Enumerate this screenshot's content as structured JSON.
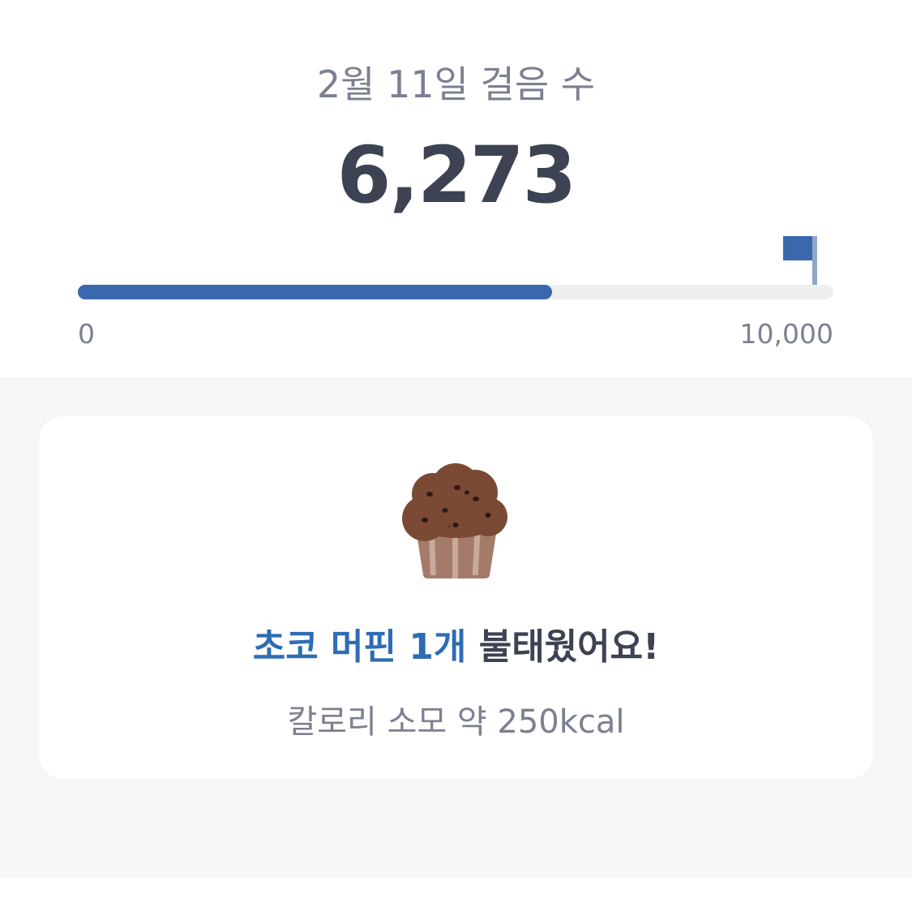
{
  "summary": {
    "date_label": "2월 11일 걸음 수",
    "steps": "6,273",
    "steps_value": 6273,
    "goal_value": 10000,
    "progress_fraction": 0.6273
  },
  "progress": {
    "min_label": "0",
    "max_label": "10,000"
  },
  "achievement": {
    "icon": "chocolate-muffin-icon",
    "headline_accent": "초코 머핀 1개",
    "headline_rest": " 불태웠어요!",
    "calorie_text": "칼로리 소모 약 250kcal"
  },
  "colors": {
    "accent": "#3a68ac",
    "headline_accent": "#2e6cb3",
    "text_dark": "#3d4352",
    "text_muted": "#7b8091",
    "track": "#efefef",
    "background": "#f6f6f6"
  }
}
